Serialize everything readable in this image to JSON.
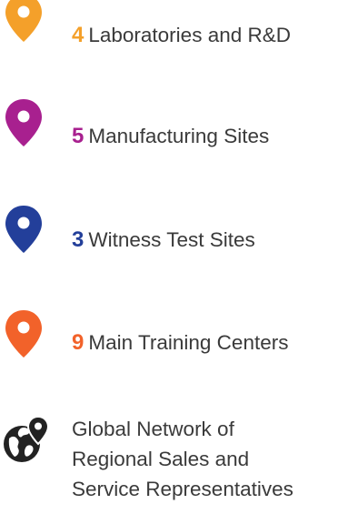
{
  "stats": [
    {
      "number": "4",
      "label": "Laboratories and R&D",
      "color": "#f4a02a",
      "icon": "map-pin-icon"
    },
    {
      "number": "5",
      "label": "Manufacturing Sites",
      "color": "#a8208f",
      "icon": "map-pin-icon"
    },
    {
      "number": "3",
      "label": "Witness Test Sites",
      "color": "#233f9a",
      "icon": "map-pin-icon"
    },
    {
      "number": "9",
      "label": "Main Training Centers",
      "color": "#f2622a",
      "icon": "map-pin-icon"
    }
  ],
  "network": {
    "icon": "globe-pin-icon",
    "lines": [
      "Global Network of",
      "Regional Sales and",
      "Service Representatives"
    ]
  }
}
